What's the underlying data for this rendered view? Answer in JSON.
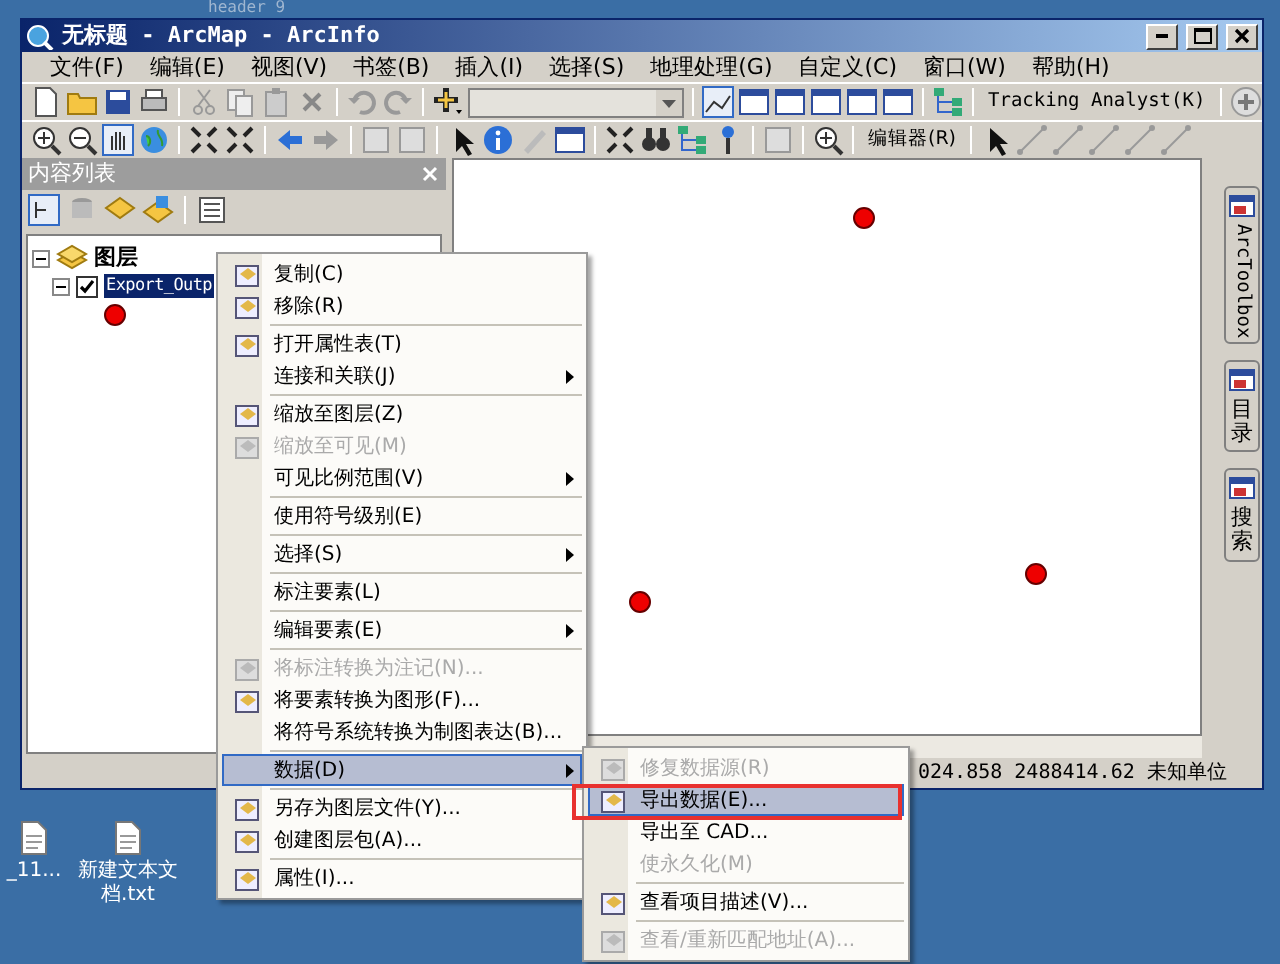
{
  "desktop": {
    "caption": "header 9",
    "icons": [
      {
        "label": "_11..."
      },
      {
        "label": "新建文本文档.txt"
      }
    ]
  },
  "window": {
    "title": "无标题 - ArcMap - ArcInfo"
  },
  "menu_bar": [
    {
      "label": "文件(F)"
    },
    {
      "label": "编辑(E)"
    },
    {
      "label": "视图(V)"
    },
    {
      "label": "书签(B)"
    },
    {
      "label": "插入(I)"
    },
    {
      "label": "选择(S)"
    },
    {
      "label": "地理处理(G)"
    },
    {
      "label": "自定义(C)"
    },
    {
      "label": "窗口(W)"
    },
    {
      "label": "帮助(H)"
    }
  ],
  "toolbar": {
    "tracking_analyst": "Tracking Analyst(K)",
    "editor": "编辑器(R)"
  },
  "toc": {
    "title": "内容列表",
    "tree": [
      {
        "label": "图层",
        "children": [
          {
            "label": "Export_Outp",
            "checked": true,
            "selected": true
          }
        ]
      }
    ]
  },
  "dock_tabs": [
    {
      "label": "ArcToolbox",
      "kind": "latin"
    },
    {
      "label": "目录",
      "kind": "cjk"
    },
    {
      "label": "搜索",
      "kind": "cjk"
    }
  ],
  "status_bar": {
    "coords": "024.858  2488414.62 未知单位"
  },
  "context_menu": [
    {
      "kind": "item",
      "label": "复制(C)",
      "icon": true,
      "disabled": false,
      "submenu": false,
      "selected": false
    },
    {
      "kind": "item",
      "label": "移除(R)",
      "icon": true,
      "disabled": false,
      "submenu": false,
      "selected": false
    },
    {
      "kind": "separator"
    },
    {
      "kind": "item",
      "label": "打开属性表(T)",
      "icon": true,
      "disabled": false,
      "submenu": false,
      "selected": false
    },
    {
      "kind": "item",
      "label": "连接和关联(J)",
      "icon": false,
      "disabled": false,
      "submenu": true,
      "selected": false
    },
    {
      "kind": "separator"
    },
    {
      "kind": "item",
      "label": "缩放至图层(Z)",
      "icon": true,
      "disabled": false,
      "submenu": false,
      "selected": false
    },
    {
      "kind": "item",
      "label": "缩放至可见(M)",
      "icon": true,
      "disabled": true,
      "submenu": false,
      "selected": false
    },
    {
      "kind": "item",
      "label": "可见比例范围(V)",
      "icon": false,
      "disabled": false,
      "submenu": true,
      "selected": false
    },
    {
      "kind": "separator"
    },
    {
      "kind": "item",
      "label": "使用符号级别(E)",
      "icon": false,
      "disabled": false,
      "submenu": false,
      "selected": false
    },
    {
      "kind": "separator"
    },
    {
      "kind": "item",
      "label": "选择(S)",
      "icon": false,
      "disabled": false,
      "submenu": true,
      "selected": false
    },
    {
      "kind": "separator"
    },
    {
      "kind": "item",
      "label": "标注要素(L)",
      "icon": false,
      "disabled": false,
      "submenu": false,
      "selected": false
    },
    {
      "kind": "separator"
    },
    {
      "kind": "item",
      "label": "编辑要素(E)",
      "icon": false,
      "disabled": false,
      "submenu": true,
      "selected": false
    },
    {
      "kind": "separator"
    },
    {
      "kind": "item",
      "label": "将标注转换为注记(N)...",
      "icon": true,
      "disabled": true,
      "submenu": false,
      "selected": false
    },
    {
      "kind": "item",
      "label": "将要素转换为图形(F)...",
      "icon": true,
      "disabled": false,
      "submenu": false,
      "selected": false
    },
    {
      "kind": "item",
      "label": "将符号系统转换为制图表达(B)...",
      "icon": false,
      "disabled": false,
      "submenu": false,
      "selected": false
    },
    {
      "kind": "separator"
    },
    {
      "kind": "item",
      "label": "数据(D)",
      "icon": false,
      "disabled": false,
      "submenu": true,
      "selected": true
    },
    {
      "kind": "separator"
    },
    {
      "kind": "item",
      "label": "另存为图层文件(Y)...",
      "icon": true,
      "disabled": false,
      "submenu": false,
      "selected": false
    },
    {
      "kind": "item",
      "label": "创建图层包(A)...",
      "icon": true,
      "disabled": false,
      "submenu": false,
      "selected": false
    },
    {
      "kind": "separator"
    },
    {
      "kind": "item",
      "label": "属性(I)...",
      "icon": true,
      "disabled": false,
      "submenu": false,
      "selected": false
    }
  ],
  "submenu": [
    {
      "kind": "item",
      "label": "修复数据源(R)",
      "icon": true,
      "disabled": true,
      "highlighted": false
    },
    {
      "kind": "item",
      "label": "导出数据(E)...",
      "icon": true,
      "disabled": false,
      "highlighted": true
    },
    {
      "kind": "item",
      "label": "导出至 CAD...",
      "icon": false,
      "disabled": false,
      "highlighted": false
    },
    {
      "kind": "item",
      "label": "使永久化(M)",
      "icon": false,
      "disabled": true,
      "highlighted": false
    },
    {
      "kind": "separator"
    },
    {
      "kind": "item",
      "label": "查看项目描述(V)...",
      "icon": true,
      "disabled": false,
      "highlighted": false
    },
    {
      "kind": "separator"
    },
    {
      "kind": "item",
      "label": "查看/重新匹配地址(A)...",
      "icon": true,
      "disabled": true,
      "highlighted": false
    }
  ]
}
